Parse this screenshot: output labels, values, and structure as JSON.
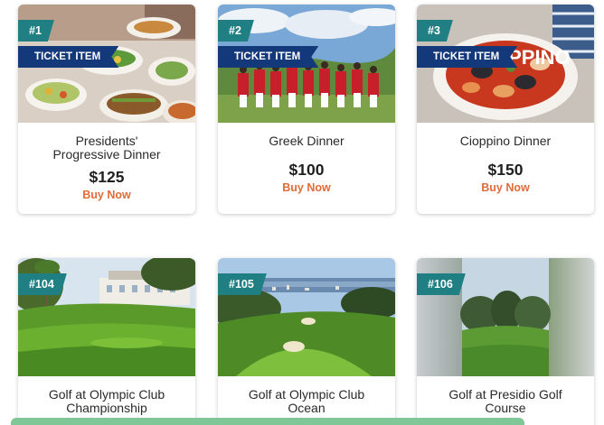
{
  "items": [
    {
      "number": "#1",
      "badge": "TICKET ITEM",
      "title": "Presidents' Progressive Dinner",
      "price": "$125",
      "buy": "Buy Now",
      "image": "buffet-dishes-image"
    },
    {
      "number": "#2",
      "badge": "TICKET ITEM",
      "title": "Greek Dinner",
      "price": "$100",
      "buy": "Buy Now",
      "image": "greek-dancers-image"
    },
    {
      "number": "#3",
      "badge": "TICKET ITEM",
      "title": "Cioppino Dinner",
      "price": "$150",
      "buy": "Buy Now",
      "image": "cioppino-bowl-image"
    },
    {
      "number": "#104",
      "title": "Golf at Olympic Club Championship",
      "image": "golf-clubhouse-image"
    },
    {
      "number": "#105",
      "title": "Golf at Olympic Club Ocean",
      "image": "golf-ocean-image"
    },
    {
      "number": "#106",
      "title": "Golf at Presidio Golf Course",
      "image": "golf-presidio-image"
    }
  ],
  "image_text": {
    "cioppino_sign": "CIOPPINO"
  },
  "colors": {
    "number_tag": "#1f7f82",
    "ticket_ribbon": "#14397a",
    "buy_now": "#e06c3a",
    "bottom_bar": "#7fc796"
  }
}
